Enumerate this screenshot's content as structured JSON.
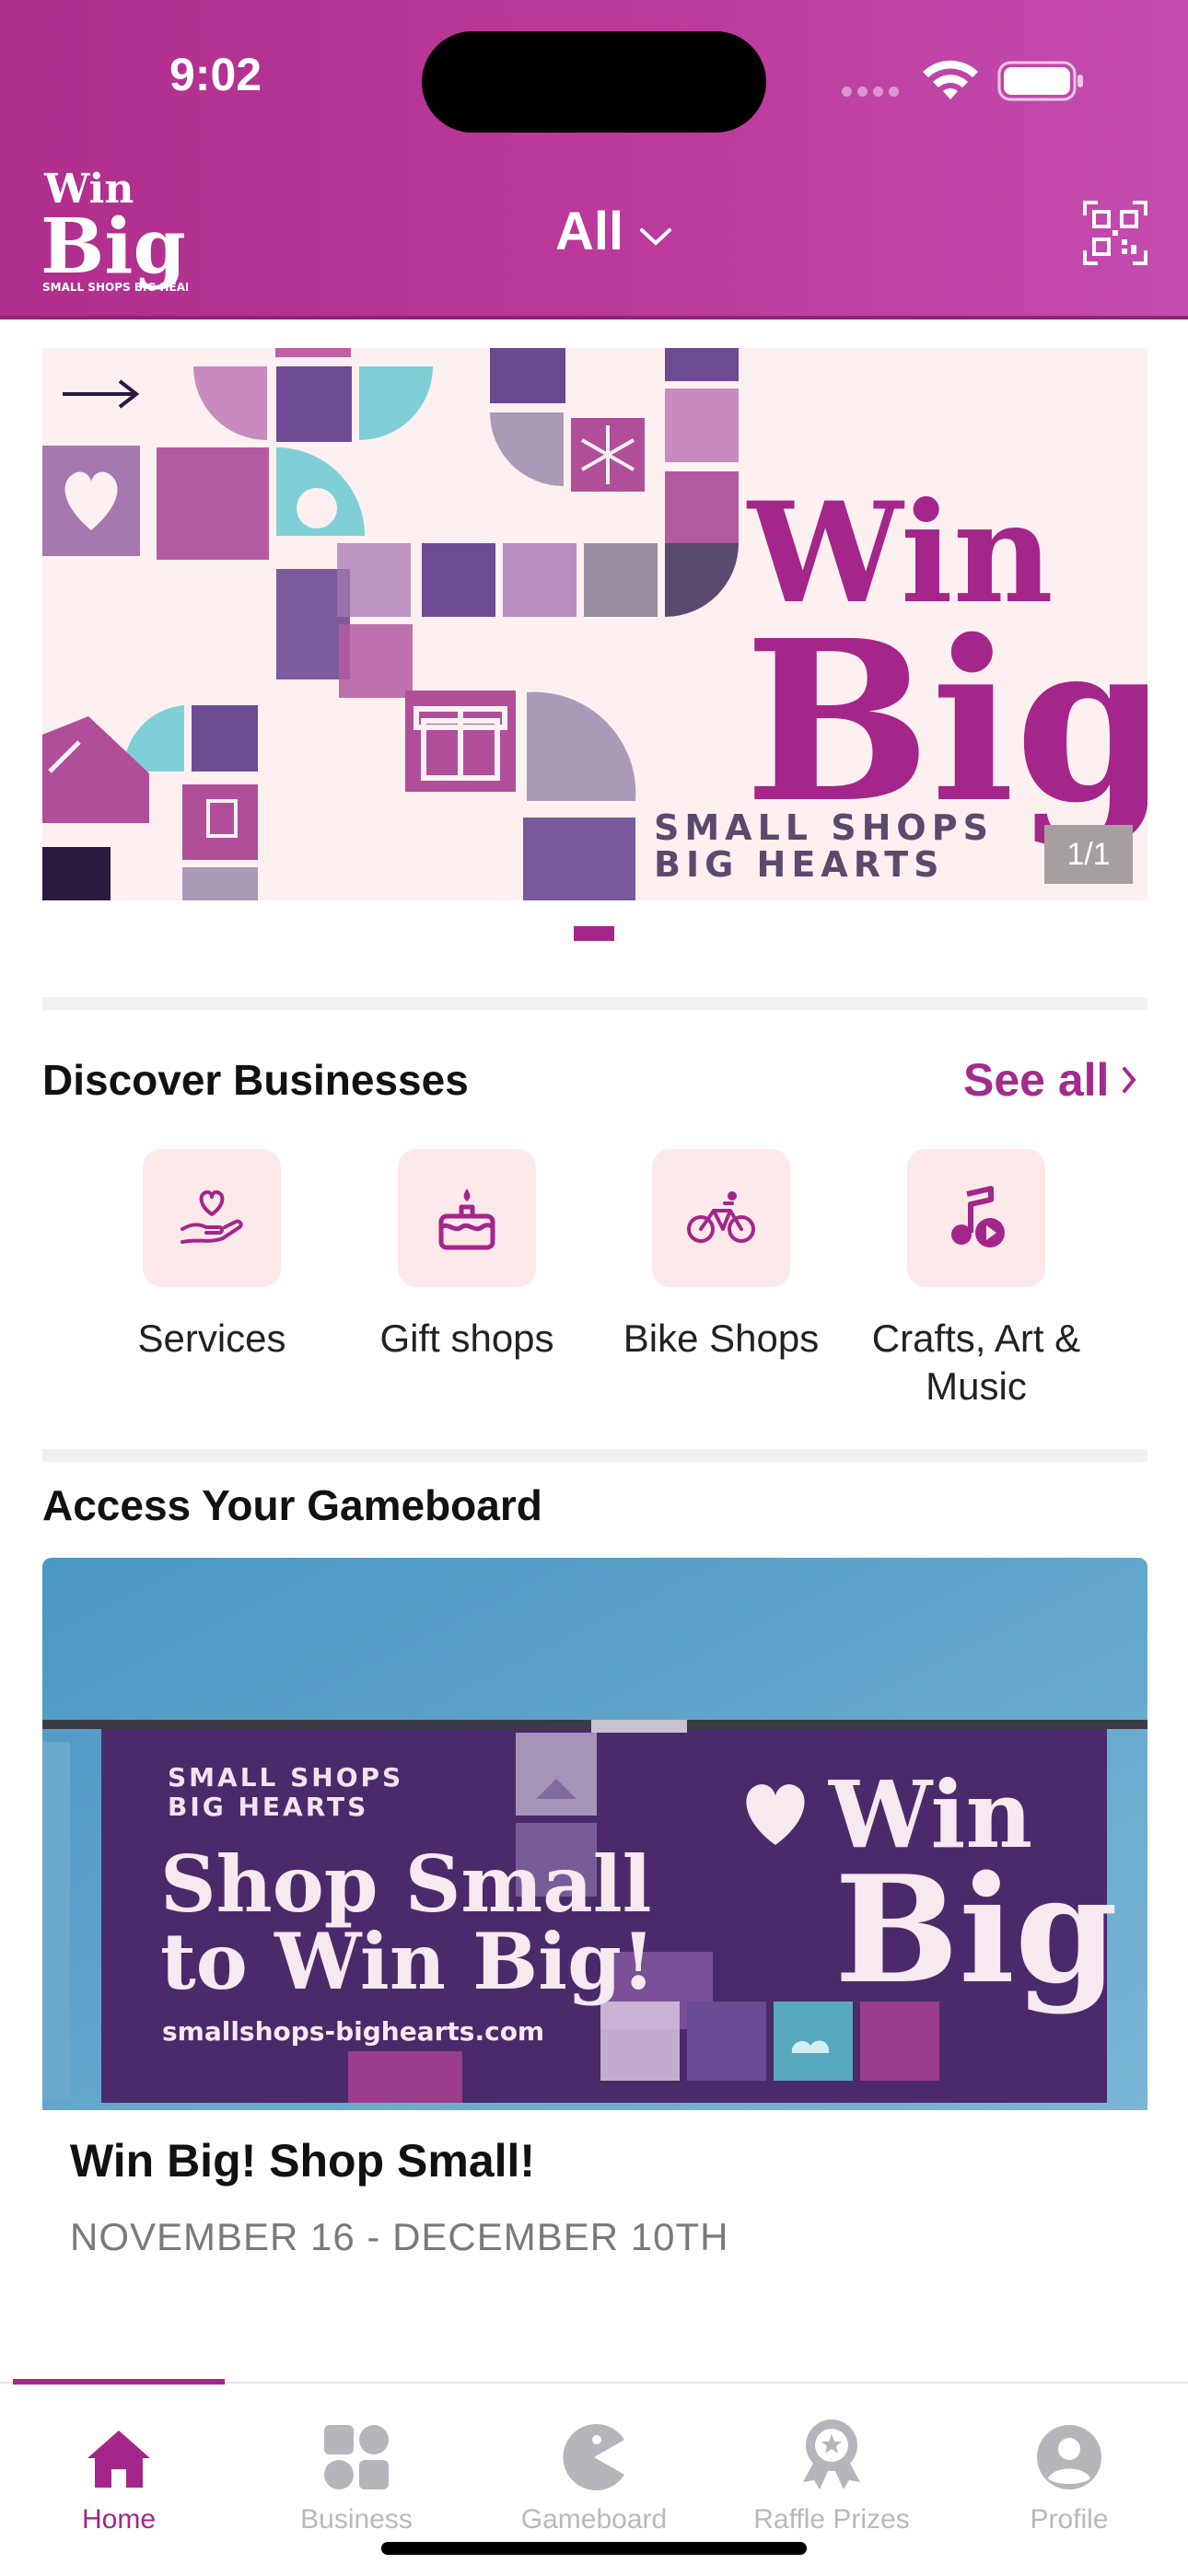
{
  "status_bar": {
    "time": "9:02"
  },
  "header": {
    "logo": {
      "line1": "Win",
      "line2": "Big",
      "tagline": "SMALL SHOPS BIG HEARTS"
    },
    "filter_label": "All"
  },
  "hero": {
    "counter": "1/1",
    "title_line1": "Win",
    "title_line2": "Big",
    "tagline_line1": "SMALL SHOPS",
    "tagline_line2": "BIG HEARTS"
  },
  "discover": {
    "title": "Discover Businesses",
    "see_all": "See all",
    "categories": [
      {
        "label": "Services",
        "icon": "heart-hand-icon"
      },
      {
        "label": "Gift shops",
        "icon": "cake-icon"
      },
      {
        "label": "Bike Shops",
        "icon": "bike-icon"
      },
      {
        "label": "Crafts, Art & Music",
        "icon": "music-note-icon"
      }
    ]
  },
  "gameboard": {
    "title": "Access Your Gameboard",
    "banner": {
      "tag_line1": "SMALL SHOPS",
      "tag_line2": "BIG HEARTS",
      "headline1": "Shop Small",
      "headline2": "to Win Big!",
      "url": "smallshops-bighearts.com",
      "win": "Win",
      "big": "Big"
    },
    "event_title": "Win Big! Shop Small!",
    "event_dates": "NOVEMBER 16 - DECEMBER 10TH"
  },
  "tabs": [
    {
      "label": "Home",
      "icon": "home-icon",
      "active": true
    },
    {
      "label": "Business",
      "icon": "grid-icon",
      "active": false
    },
    {
      "label": "Gameboard",
      "icon": "pacman-icon",
      "active": false
    },
    {
      "label": "Raffle Prizes",
      "icon": "award-icon",
      "active": false
    },
    {
      "label": "Profile",
      "icon": "profile-icon",
      "active": false
    }
  ],
  "colors": {
    "brand": "#b02e8c",
    "accent": "#a4268a",
    "tile_bg": "#fde9ea",
    "hero_bg": "#fdf0f1",
    "banner_purple": "#4b2a6b"
  }
}
